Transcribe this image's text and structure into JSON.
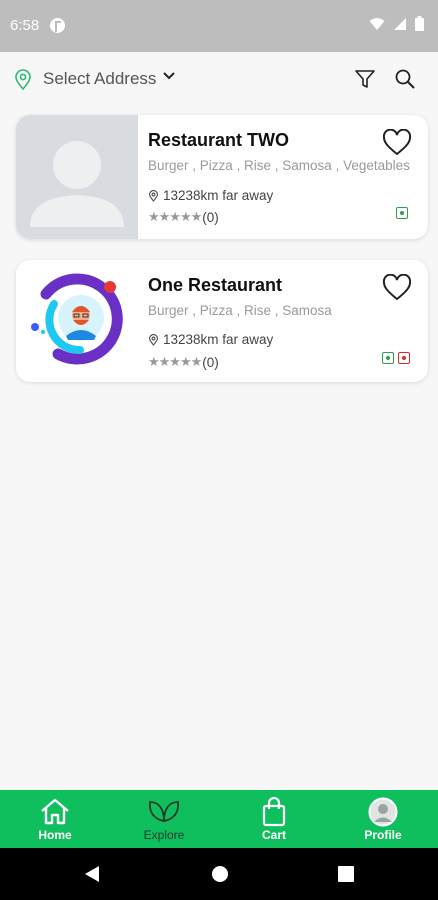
{
  "status_bar": {
    "time": "6:58"
  },
  "header": {
    "address_label": "Select Address"
  },
  "restaurants": [
    {
      "name": "Restaurant TWO",
      "tags": "Burger , Pizza , Rise , Samosa , Vegetables",
      "distance": "13238km far away",
      "stars": "★★★★★",
      "rating_count": "(0)"
    },
    {
      "name": "One Restaurant",
      "tags": "Burger , Pizza , Rise , Samosa",
      "distance": "13238km far away",
      "stars": "★★★★★",
      "rating_count": "(0)"
    }
  ],
  "bottom_nav": {
    "items": [
      {
        "label": "Home",
        "icon": "home-icon"
      },
      {
        "label": "Explore",
        "icon": "leaf-icon"
      },
      {
        "label": "Cart",
        "icon": "bag-icon"
      },
      {
        "label": "Profile",
        "icon": "profile-icon"
      }
    ]
  },
  "colors": {
    "accent_green": "#0fbf5e",
    "veg_green": "#2e9d4e",
    "nonveg_red": "#d32f2f",
    "logo_purple": "#6a2fc4",
    "logo_cyan": "#1ec8f0"
  }
}
